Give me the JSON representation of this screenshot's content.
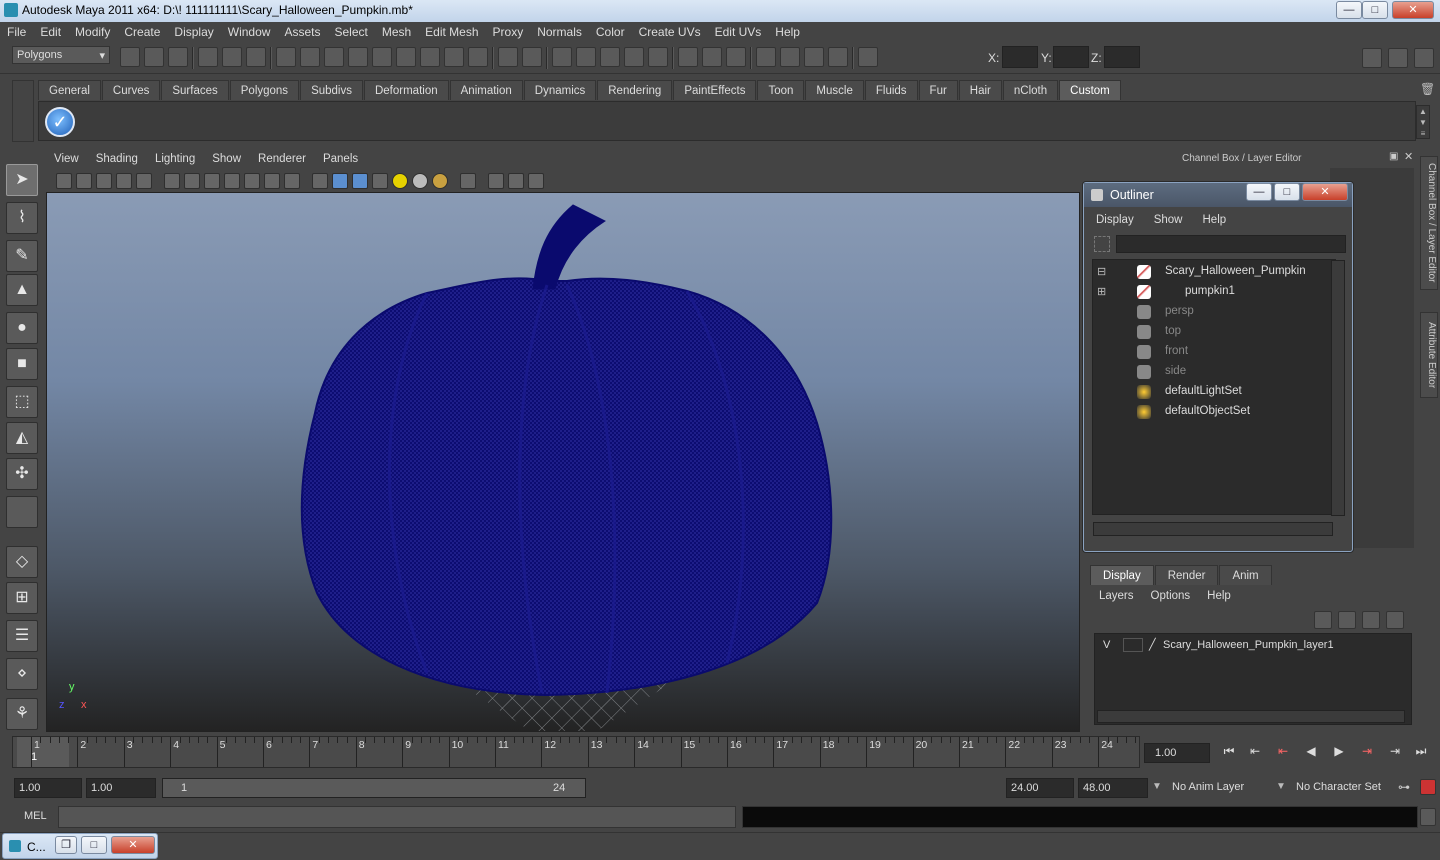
{
  "window": {
    "title": "Autodesk Maya 2011 x64: D:\\! 111111111\\Scary_Halloween_Pumpkin.mb*",
    "min": "—",
    "max": "□",
    "close": "✕"
  },
  "menus": [
    "File",
    "Edit",
    "Modify",
    "Create",
    "Display",
    "Window",
    "Assets",
    "Select",
    "Mesh",
    "Edit Mesh",
    "Proxy",
    "Normals",
    "Color",
    "Create UVs",
    "Edit UVs",
    "Help"
  ],
  "statusline": {
    "mode": "Polygons",
    "x_label": "X:",
    "y_label": "Y:",
    "z_label": "Z:"
  },
  "shelf_tabs": [
    "General",
    "Curves",
    "Surfaces",
    "Polygons",
    "Subdivs",
    "Deformation",
    "Animation",
    "Dynamics",
    "Rendering",
    "PaintEffects",
    "Toon",
    "Muscle",
    "Fluids",
    "Fur",
    "Hair",
    "nCloth",
    "Custom"
  ],
  "shelf_active": "Custom",
  "viewport": {
    "menus": [
      "View",
      "Shading",
      "Lighting",
      "Show",
      "Renderer",
      "Panels"
    ],
    "axis_y": "y",
    "axis_x": "x",
    "axis_z": "z"
  },
  "channelbox": {
    "title": "Channel Box / Layer Editor"
  },
  "outliner": {
    "title": "Outliner",
    "menus": [
      "Display",
      "Show",
      "Help"
    ],
    "items": [
      {
        "label": "Scary_Halloween_Pumpkin",
        "icon": "mesh-icon",
        "dim": false,
        "expander": "⊟"
      },
      {
        "label": "pumpkin1",
        "icon": "mesh-icon",
        "dim": false,
        "expander": "⊞"
      },
      {
        "label": "persp",
        "icon": "camera-icon",
        "dim": true,
        "expander": ""
      },
      {
        "label": "top",
        "icon": "camera-icon",
        "dim": true,
        "expander": ""
      },
      {
        "label": "front",
        "icon": "camera-icon",
        "dim": true,
        "expander": ""
      },
      {
        "label": "side",
        "icon": "camera-icon",
        "dim": true,
        "expander": ""
      },
      {
        "label": "defaultLightSet",
        "icon": "set-icon",
        "dim": false,
        "expander": ""
      },
      {
        "label": "defaultObjectSet",
        "icon": "set-icon",
        "dim": false,
        "expander": ""
      }
    ]
  },
  "layers": {
    "tabs": [
      "Display",
      "Render",
      "Anim"
    ],
    "active": "Display",
    "menus": [
      "Layers",
      "Options",
      "Help"
    ],
    "rows": [
      {
        "v": "V",
        "name": "Scary_Halloween_Pumpkin_layer1"
      }
    ]
  },
  "sidetabs": [
    "Channel Box / Layer Editor",
    "Attribute Editor"
  ],
  "timeline": {
    "ticks": [
      "1",
      "2",
      "3",
      "4",
      "5",
      "6",
      "7",
      "8",
      "9",
      "10",
      "11",
      "12",
      "13",
      "14",
      "15",
      "16",
      "17",
      "18",
      "19",
      "20",
      "21",
      "22",
      "23",
      "24"
    ],
    "current": "1.00",
    "current_marker": "1"
  },
  "range": {
    "start": "1.00",
    "playstart": "1.00",
    "slider_start": "1",
    "slider_end": "24",
    "playend": "24.00",
    "end": "48.00",
    "anim_layer": "No Anim Layer",
    "char_set": "No Character Set"
  },
  "mel": {
    "label": "MEL"
  },
  "taskbar": {
    "label": "C..."
  },
  "colors": {
    "wire": "#0a0a6e",
    "accent": "#8aa2c0"
  }
}
